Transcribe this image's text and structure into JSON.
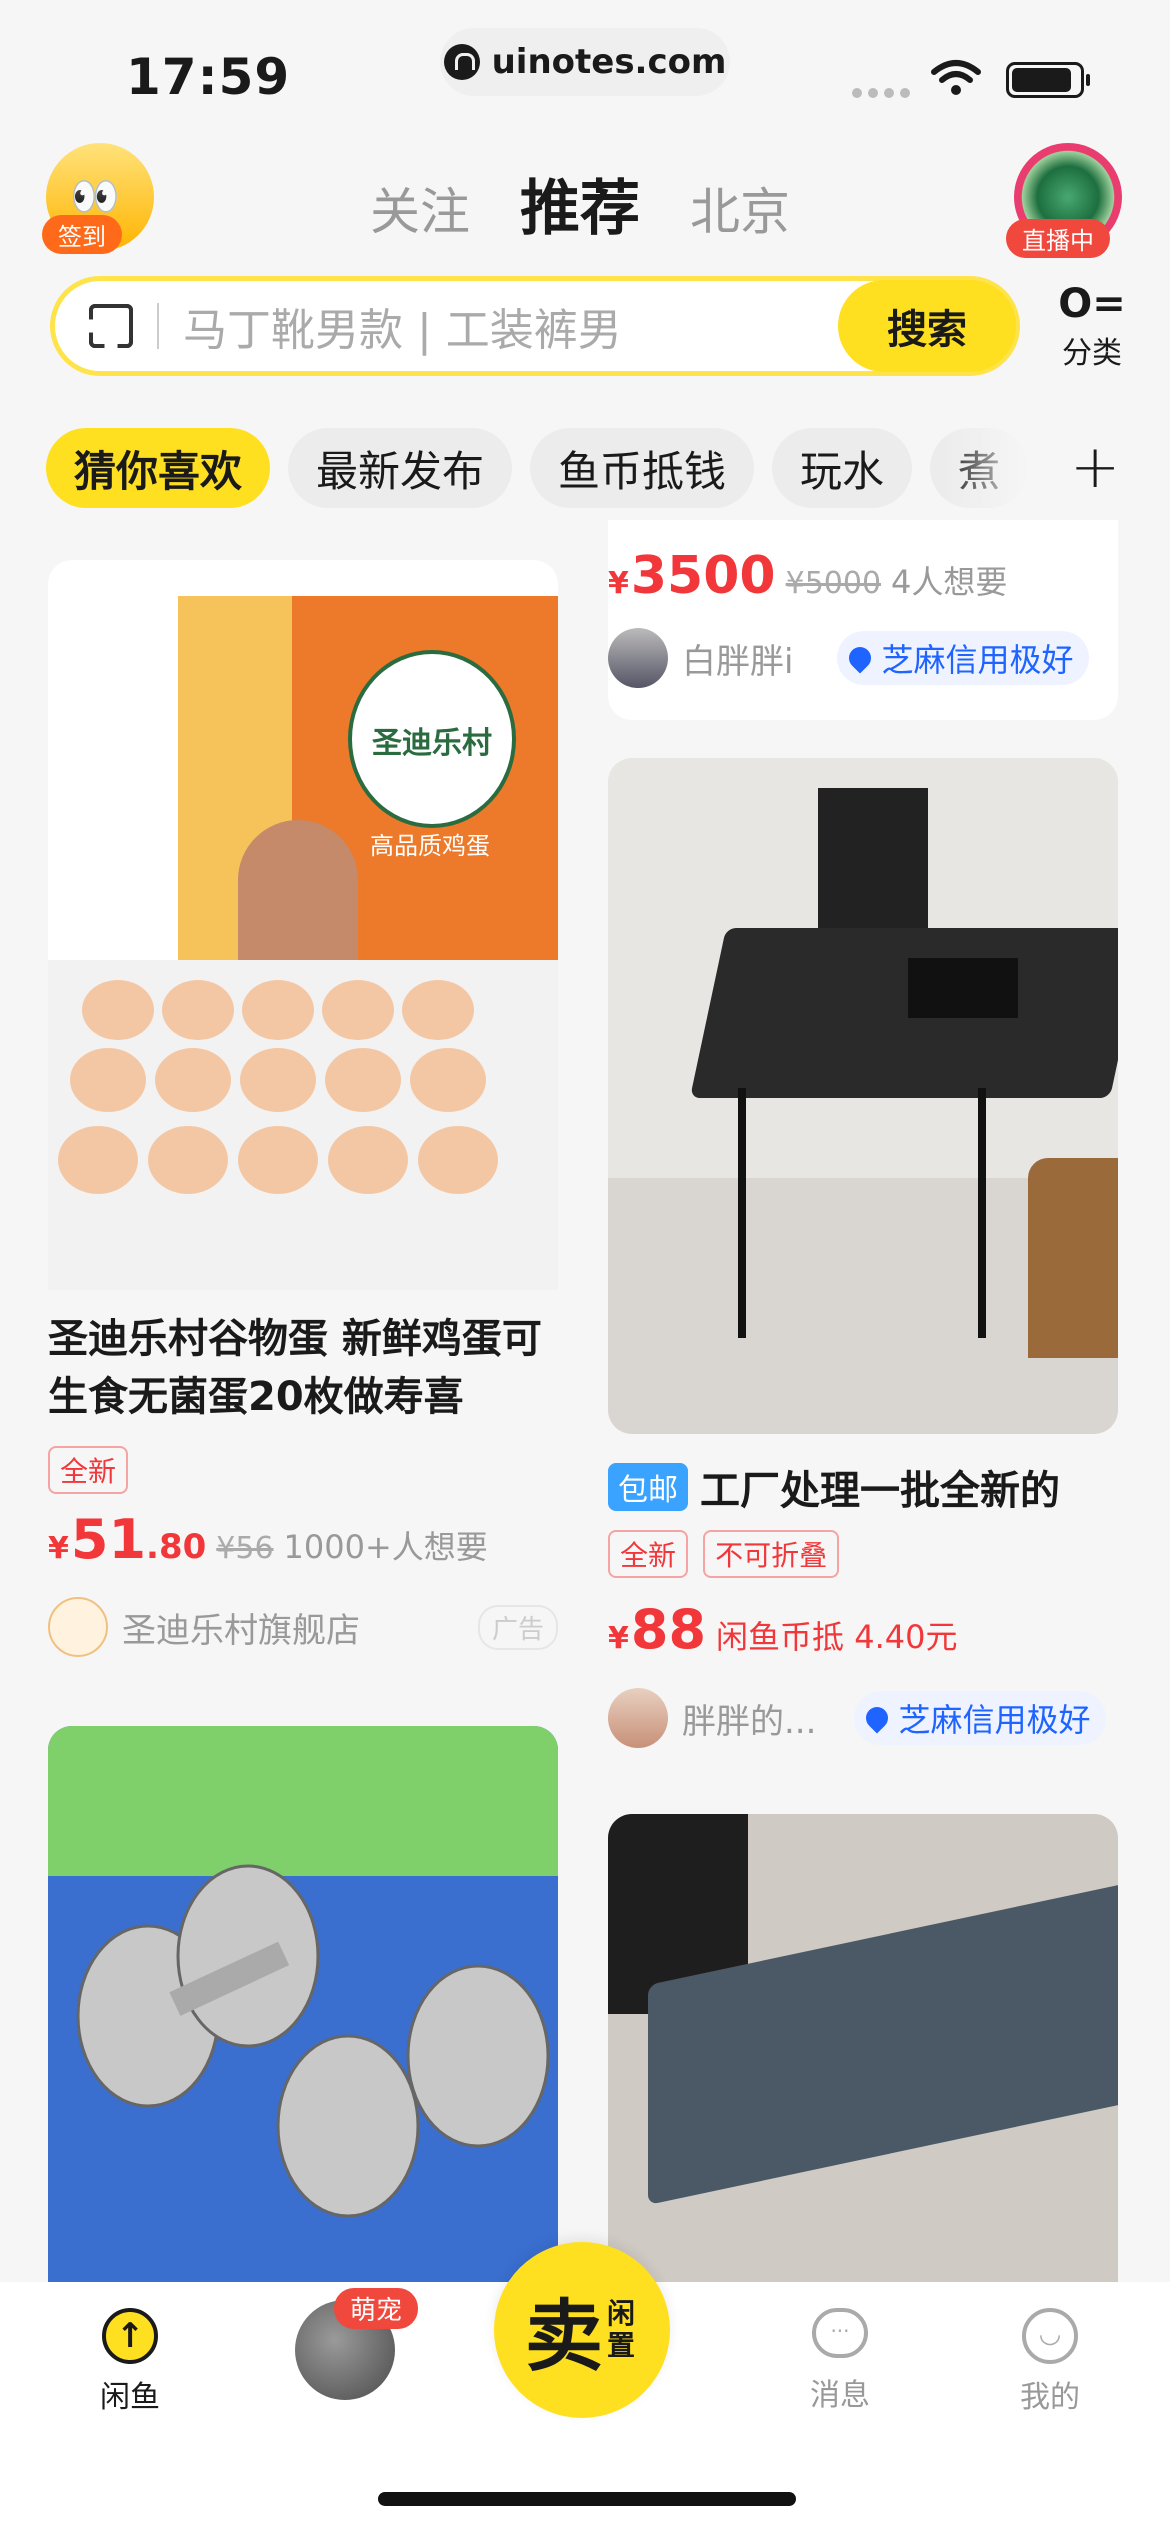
{
  "status": {
    "time": "17:59",
    "url": "uinotes.com"
  },
  "header": {
    "checkin_label": "签到",
    "live_label": "直播中",
    "tabs": [
      {
        "label": "关注"
      },
      {
        "label": "推荐"
      },
      {
        "label": "北京"
      }
    ]
  },
  "search": {
    "placeholder": "马丁靴男款 | 工装裤男",
    "button": "搜索"
  },
  "category": {
    "label": "分类",
    "icon": "category-icon"
  },
  "chips": [
    "猜你喜欢",
    "最新发布",
    "鱼币抵钱",
    "玩水",
    "煮"
  ],
  "feed": {
    "top_right": {
      "price": "3500",
      "orig": "¥5000",
      "wants": "4人想要",
      "seller": "白胖胖i",
      "credit": "芝麻信用极好"
    },
    "eggs": {
      "title": "圣迪乐村谷物蛋 新鲜鸡蛋可生食无菌蛋20枚做寿喜",
      "tag": "全新",
      "price_int": "51",
      "price_dec": ".80",
      "orig": "¥56",
      "wants": "1000+人想要",
      "shop": "圣迪乐村旗舰店",
      "ad": "广告",
      "box_brand": "圣迪乐村",
      "box_sub": "高品质鸡蛋"
    },
    "desk": {
      "badge": "包邮",
      "title": "工厂处理一批全新的",
      "tags": [
        "全新",
        "不可折叠"
      ],
      "price": "88",
      "coin": "闲鱼币抵 4.40元",
      "seller": "胖胖的...",
      "credit": "芝麻信用极好"
    }
  },
  "bottom_nav": {
    "home": "闲鱼",
    "pet": "萌宠",
    "sell": "卖",
    "sell_sub": "闲置",
    "messages": "消息",
    "mine": "我的"
  },
  "colors": {
    "yellow": "#ffe021",
    "red": "#f2373a",
    "zhima_blue": "#1f64ff"
  }
}
